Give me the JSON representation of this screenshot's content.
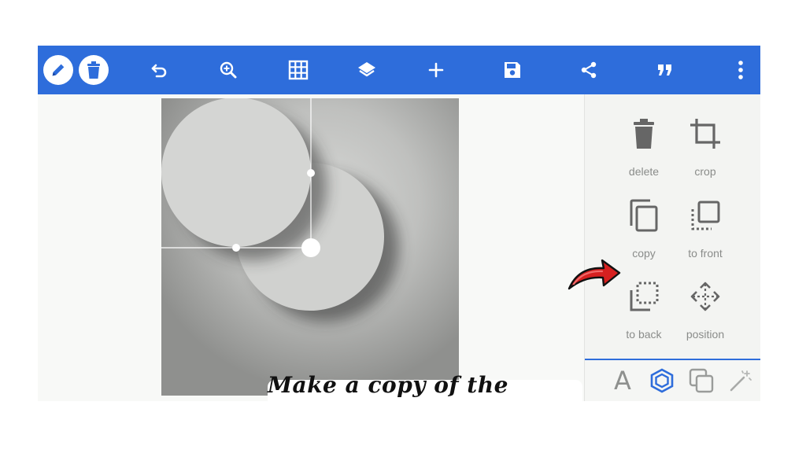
{
  "toolbar": {
    "buttons": [
      {
        "name": "edit-button",
        "icon": "pencil-icon"
      },
      {
        "name": "delete-button",
        "icon": "trash-icon"
      },
      {
        "name": "undo-button",
        "icon": "undo-icon"
      },
      {
        "name": "zoom-button",
        "icon": "zoom-in-icon"
      },
      {
        "name": "grid-button",
        "icon": "grid-icon"
      },
      {
        "name": "layers-button",
        "icon": "layers-icon"
      },
      {
        "name": "add-button",
        "icon": "plus-icon"
      },
      {
        "name": "save-button",
        "icon": "save-icon"
      },
      {
        "name": "share-button",
        "icon": "share-icon"
      },
      {
        "name": "quote-button",
        "icon": "quote-icon"
      },
      {
        "name": "more-button",
        "icon": "more-vertical-icon"
      }
    ]
  },
  "panel": {
    "delete_label": "delete",
    "crop_label": "crop",
    "copy_label": "copy",
    "to_front_label": "to front",
    "to_back_label": "to back",
    "position_label": "position",
    "tabs": [
      {
        "name": "text-tab",
        "icon": "letter-a-icon",
        "glyph": "A"
      },
      {
        "name": "shape-tab",
        "icon": "hexagon-icon",
        "active": true
      },
      {
        "name": "overlay-tab",
        "icon": "overlap-squares-icon"
      },
      {
        "name": "effects-tab",
        "icon": "magic-wand-icon"
      }
    ]
  },
  "caption": {
    "text": "Make a copy of the circle"
  },
  "colors": {
    "toolbar": "#2e6ddb",
    "accent": "#2e6ddb",
    "panel_bg": "#f3f4f2",
    "arrow": "#d62020"
  }
}
